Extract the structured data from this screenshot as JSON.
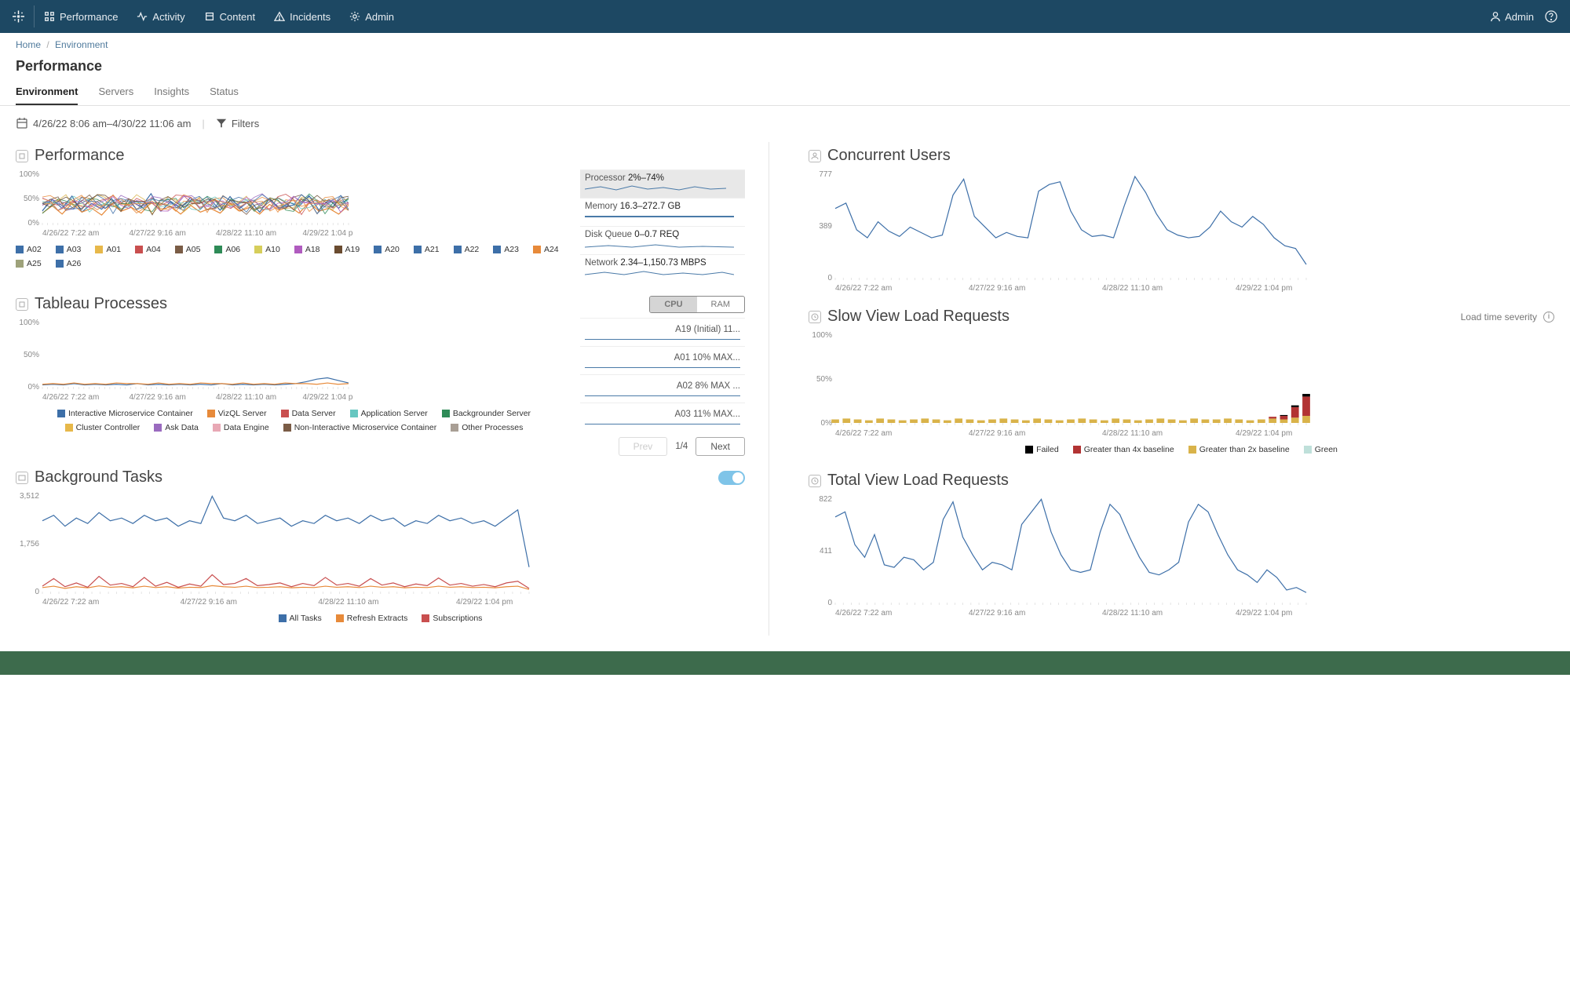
{
  "topnav": {
    "items": [
      {
        "label": "Performance"
      },
      {
        "label": "Activity"
      },
      {
        "label": "Content"
      },
      {
        "label": "Incidents"
      },
      {
        "label": "Admin"
      }
    ],
    "user": "Admin"
  },
  "breadcrumb": {
    "home": "Home",
    "current": "Environment"
  },
  "page_title": "Performance",
  "subtabs": [
    {
      "label": "Environment",
      "active": true
    },
    {
      "label": "Servers"
    },
    {
      "label": "Insights"
    },
    {
      "label": "Status"
    }
  ],
  "toolbar": {
    "date_range": "4/26/22 8:06 am–4/30/22 11:06 am",
    "filters_label": "Filters"
  },
  "panels": {
    "performance": {
      "title": "Performance",
      "metrics": [
        {
          "label": "Processor",
          "value": "2%–74%"
        },
        {
          "label": "Memory",
          "value": "16.3–272.7 GB"
        },
        {
          "label": "Disk Queue",
          "value": "0–0.7 REQ"
        },
        {
          "label": "Network",
          "value": "2.34–1,150.73 MBPS"
        }
      ],
      "legend": [
        "A02",
        "A03",
        "A01",
        "A04",
        "A05",
        "A06",
        "A10",
        "A18",
        "A19",
        "A20",
        "A21",
        "A22",
        "A23",
        "A24",
        "A25",
        "A26"
      ],
      "legend_colors": [
        "#3d6fa8",
        "#3d6fa8",
        "#e7b84a",
        "#c94f4f",
        "#7a5c46",
        "#2e8b57",
        "#d6ce5b",
        "#b05bbf",
        "#6a4b30",
        "#3d6fa8",
        "#3d6fa8",
        "#3d6fa8",
        "#3d6fa8",
        "#e78a3a",
        "#9ea27a",
        "#3d6fa8"
      ]
    },
    "concurrent": {
      "title": "Concurrent Users"
    },
    "processes": {
      "title": "Tableau Processes",
      "toggle": {
        "opt_a": "CPU",
        "opt_b": "RAM"
      },
      "list": [
        {
          "label": "A19 (Initial) 11..."
        },
        {
          "label": "A01 10% MAX..."
        },
        {
          "label": "A02 8% MAX ..."
        },
        {
          "label": "A03 11% MAX..."
        }
      ],
      "pager": {
        "prev": "Prev",
        "page": "1/4",
        "next": "Next"
      },
      "legend": [
        "Interactive Microservice Container",
        "VizQL Server",
        "Data Server",
        "Application Server",
        "Backgrounder Server",
        "Cluster Controller",
        "Ask Data",
        "Data Engine",
        "Non-Interactive Microservice Container",
        "Other Processes"
      ],
      "legend_colors": [
        "#3d6fa8",
        "#e78a3a",
        "#c94f4f",
        "#67c7c1",
        "#2e8b57",
        "#e7b84a",
        "#9a6bbf",
        "#e8a8b5",
        "#7a5c46",
        "#a99f95"
      ]
    },
    "slow_view": {
      "title": "Slow View Load Requests",
      "note": "Load time severity",
      "legend": [
        "Failed",
        "Greater than 4x baseline",
        "Greater than 2x baseline",
        "Green"
      ],
      "legend_colors": [
        "#000",
        "#b23333",
        "#d9b34a",
        "#bfe0da"
      ]
    },
    "bg_tasks": {
      "title": "Background Tasks",
      "legend": [
        "All Tasks",
        "Refresh Extracts",
        "Subscriptions"
      ],
      "legend_colors": [
        "#3d6fa8",
        "#e78a3a",
        "#c94f4f"
      ]
    },
    "total_view": {
      "title": "Total View Load Requests"
    }
  },
  "x_axis_ticks": [
    "4/26/22 7:22 am",
    "4/27/22 9:16 am",
    "4/28/22 11:10 am",
    "4/29/22 1:04 pm"
  ],
  "chart_data": [
    {
      "type": "line",
      "title": "Performance (Processor %)",
      "ylim": [
        0,
        100
      ],
      "ylabel": "%",
      "x_ticks": [
        "4/26/22 7:22 am",
        "4/27/22 9:16 am",
        "4/28/22 11:10 am",
        "4/29/22 1:04 pm"
      ],
      "note": "16 overlapping host series A01–A26; values fluctuate roughly 2%–74%",
      "series": [
        {
          "name": "A02",
          "values": [
            25,
            48,
            30,
            55,
            22,
            40,
            28,
            50,
            26,
            45,
            32,
            60,
            24,
            44,
            30,
            52,
            28,
            48,
            26,
            54,
            30,
            46,
            22,
            50,
            28,
            42,
            34,
            56,
            26,
            48,
            30,
            52
          ]
        },
        {
          "name": "A01",
          "values": [
            20,
            35,
            18,
            40,
            22,
            30,
            16,
            38,
            24,
            32,
            20,
            42,
            26,
            34,
            18,
            36,
            22,
            30,
            20,
            40,
            24,
            32,
            18,
            38,
            26,
            34,
            20,
            42,
            24,
            30,
            18,
            36
          ]
        }
      ]
    },
    {
      "type": "line",
      "title": "Concurrent Users",
      "ylim": [
        0,
        777
      ],
      "x_ticks": [
        "4/26/22 7:22 am",
        "4/27/22 9:16 am",
        "4/28/22 11:10 am",
        "4/29/22 1:04 pm"
      ],
      "series": [
        {
          "name": "Users",
          "values": [
            520,
            560,
            360,
            300,
            420,
            350,
            310,
            380,
            340,
            300,
            320,
            620,
            740,
            460,
            380,
            300,
            340,
            310,
            300,
            650,
            700,
            720,
            500,
            360,
            310,
            320,
            300,
            540,
            760,
            640,
            480,
            360,
            320,
            300,
            310,
            380,
            500,
            420,
            380,
            460,
            400,
            300,
            240,
            220,
            100
          ]
        }
      ]
    },
    {
      "type": "line",
      "title": "Tableau Processes (CPU %)",
      "ylim": [
        0,
        100
      ],
      "x_ticks": [
        "4/26/22 7:22 am",
        "4/27/22 9:16 am",
        "4/28/22 11:10 am",
        "4/29/22 1:04 pm"
      ],
      "note": "Many process series mostly 0–8%, one brief rise to ~15% near end",
      "series": [
        {
          "name": "Interactive Microservice Container",
          "values": [
            3,
            4,
            3,
            5,
            3,
            4,
            3,
            4,
            3,
            5,
            3,
            4,
            3,
            4,
            3,
            4,
            3,
            5,
            3,
            4,
            3,
            4,
            3,
            4,
            5,
            8,
            12,
            14,
            10,
            6
          ]
        },
        {
          "name": "VizQL Server",
          "values": [
            4,
            5,
            4,
            6,
            4,
            5,
            4,
            6,
            5,
            5,
            4,
            6,
            4,
            5,
            4,
            6,
            5,
            5,
            4,
            6,
            4,
            5,
            4,
            6,
            5,
            5,
            4,
            6,
            4,
            5
          ]
        }
      ]
    },
    {
      "type": "bar",
      "title": "Slow View Load Requests",
      "ylim": [
        0,
        100
      ],
      "ylabel": "%",
      "x_ticks": [
        "4/26/22 7:22 am",
        "4/27/22 9:16 am",
        "4/28/22 11:10 am",
        "4/29/22 1:04 pm"
      ],
      "note": "stacked bars per time bucket",
      "series": [
        {
          "name": "Greater than 2x baseline",
          "values": [
            4,
            5,
            4,
            3,
            5,
            4,
            3,
            4,
            5,
            4,
            3,
            5,
            4,
            3,
            4,
            5,
            4,
            3,
            5,
            4,
            3,
            4,
            5,
            4,
            3,
            5,
            4,
            3,
            4,
            5,
            4,
            3,
            5,
            4,
            4,
            5,
            4,
            3,
            4,
            5,
            4,
            6,
            8
          ]
        },
        {
          "name": "Greater than 4x baseline",
          "values": [
            0,
            0,
            0,
            0,
            0,
            0,
            0,
            0,
            0,
            0,
            0,
            0,
            0,
            0,
            0,
            0,
            0,
            0,
            0,
            0,
            0,
            0,
            0,
            0,
            0,
            0,
            0,
            0,
            0,
            0,
            0,
            0,
            0,
            0,
            0,
            0,
            0,
            0,
            0,
            2,
            4,
            12,
            22
          ]
        },
        {
          "name": "Failed",
          "values": [
            0,
            0,
            0,
            0,
            0,
            0,
            0,
            0,
            0,
            0,
            0,
            0,
            0,
            0,
            0,
            0,
            0,
            0,
            0,
            0,
            0,
            0,
            0,
            0,
            0,
            0,
            0,
            0,
            0,
            0,
            0,
            0,
            0,
            0,
            0,
            0,
            0,
            0,
            0,
            0,
            1,
            2,
            3
          ]
        }
      ]
    },
    {
      "type": "line",
      "title": "Background Tasks",
      "ylim": [
        0,
        3512
      ],
      "x_ticks": [
        "4/26/22 7:22 am",
        "4/27/22 9:16 am",
        "4/28/22 11:10 am",
        "4/29/22 1:04 pm"
      ],
      "series": [
        {
          "name": "All Tasks",
          "values": [
            2600,
            2800,
            2400,
            2700,
            2500,
            2900,
            2600,
            2700,
            2500,
            2800,
            2600,
            2700,
            2400,
            2600,
            2500,
            3500,
            2700,
            2600,
            2800,
            2500,
            2600,
            2700,
            2400,
            2600,
            2500,
            2800,
            2600,
            2700,
            2500,
            2800,
            2600,
            2700,
            2400,
            2600,
            2500,
            2800,
            2600,
            2700,
            2500,
            2600,
            2400,
            2700,
            3000,
            900
          ]
        },
        {
          "name": "Refresh Extracts",
          "values": [
            150,
            200,
            120,
            180,
            140,
            210,
            160,
            180,
            140,
            200,
            150,
            180,
            130,
            160,
            150,
            220,
            180,
            160,
            200,
            150,
            160,
            180,
            140,
            160,
            150,
            200,
            160,
            180,
            150,
            200,
            160,
            180,
            140,
            160,
            150,
            200,
            160,
            180,
            150,
            160,
            140,
            180,
            200,
            80
          ]
        },
        {
          "name": "Subscriptions",
          "values": [
            200,
            480,
            180,
            320,
            160,
            560,
            240,
            300,
            180,
            520,
            200,
            340,
            160,
            280,
            200,
            620,
            260,
            300,
            480,
            220,
            260,
            320,
            180,
            300,
            220,
            520,
            240,
            300,
            200,
            480,
            240,
            320,
            180,
            280,
            220,
            500,
            240,
            300,
            200,
            260,
            180,
            320,
            380,
            120
          ]
        }
      ]
    },
    {
      "type": "line",
      "title": "Total View Load Requests",
      "ylim": [
        0,
        822
      ],
      "x_ticks": [
        "4/26/22 7:22 am",
        "4/27/22 9:16 am",
        "4/28/22 11:10 am",
        "4/29/22 1:04 pm"
      ],
      "series": [
        {
          "name": "Requests",
          "values": [
            680,
            720,
            460,
            360,
            540,
            300,
            280,
            360,
            340,
            260,
            320,
            660,
            800,
            520,
            380,
            260,
            320,
            300,
            260,
            620,
            720,
            820,
            560,
            380,
            260,
            240,
            260,
            560,
            780,
            700,
            520,
            360,
            240,
            220,
            260,
            320,
            640,
            780,
            720,
            540,
            380,
            260,
            220,
            160,
            260,
            200,
            100,
            120,
            80
          ]
        }
      ]
    }
  ]
}
